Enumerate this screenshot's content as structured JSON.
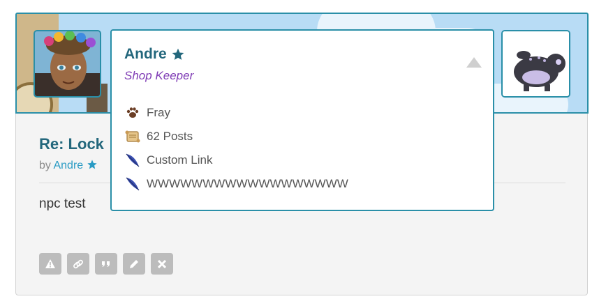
{
  "popup": {
    "name": "Andre",
    "role": "Shop Keeper",
    "stats": [
      {
        "icon": "paw-icon",
        "label": "Fray"
      },
      {
        "icon": "scroll-icon",
        "label": "62 Posts"
      },
      {
        "icon": "feather-icon",
        "label": "Custom Link"
      },
      {
        "icon": "feather-icon",
        "label": "WWWWWWWWWWWWWWWWWW"
      }
    ],
    "star_icon": "star-icon",
    "collapse_icon": "collapse-arrow-icon"
  },
  "post": {
    "title": "Re: Lock",
    "by_prefix": "by",
    "author": "Andre",
    "body": "npc test",
    "actions": [
      {
        "icon": "warning-icon",
        "name": "report-button"
      },
      {
        "icon": "link-icon",
        "name": "permalink-button"
      },
      {
        "icon": "quote-icon",
        "name": "quote-button"
      },
      {
        "icon": "pencil-icon",
        "name": "edit-button"
      },
      {
        "icon": "close-icon",
        "name": "delete-button"
      }
    ]
  },
  "colors": {
    "accent": "#2a8fa8",
    "title": "#23677c",
    "role": "#7f3cb5",
    "banner_sky": "#b8dcf5"
  }
}
